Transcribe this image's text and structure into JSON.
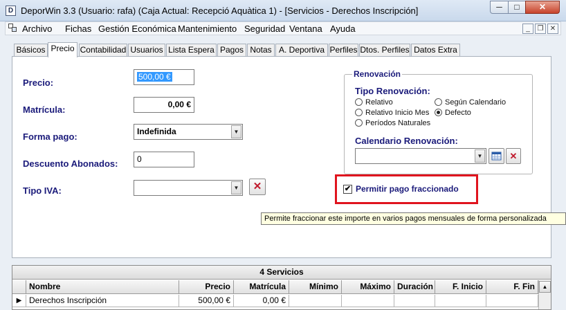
{
  "window": {
    "title": "DeporWin 3.3  (Usuario: rafa)  (Caja Actual: Recepció Aquàtica 1) - [Servicios - Derechos Inscripción]",
    "icon_letter": "D",
    "min_glyph": "─",
    "max_glyph": "□",
    "close_glyph": "✕"
  },
  "menu": {
    "items": [
      "Archivo",
      "Fichas",
      "Gestión Económica",
      "Mantenimiento",
      "Seguridad",
      "Ventana",
      "Ayuda"
    ],
    "mdi_min": "_",
    "mdi_restore": "❐",
    "mdi_close": "✕"
  },
  "tabs": [
    {
      "label": "Básicos",
      "active": false
    },
    {
      "label": "Precio",
      "active": true
    },
    {
      "label": "Contabilidad",
      "active": false
    },
    {
      "label": "Usuarios",
      "active": false
    },
    {
      "label": "Lista Espera",
      "active": false
    },
    {
      "label": "Pagos",
      "active": false
    },
    {
      "label": "Notas",
      "active": false
    },
    {
      "label": "A. Deportiva",
      "active": false
    },
    {
      "label": "Perfiles",
      "active": false
    },
    {
      "label": "Dtos. Perfiles",
      "active": false
    },
    {
      "label": "Datos Extra",
      "active": false
    }
  ],
  "form": {
    "precio_label": "Precio:",
    "precio_value": "500,00 €",
    "matricula_label": "Matrícula:",
    "matricula_value": "0,00 €",
    "forma_pago_label": "Forma pago:",
    "forma_pago_value": "Indefinida",
    "descuento_label": "Descuento Abonados:",
    "descuento_value": "0",
    "tipo_iva_label": "Tipo IVA:",
    "tipo_iva_value": "",
    "clear_glyph": "✕"
  },
  "renovacion": {
    "legend": "Renovación",
    "tipo_label": "Tipo Renovación:",
    "options": {
      "relativo": "Relativo",
      "relativo_inicio_mes": "Relativo Inicio Mes",
      "periodos_naturales": "Períodos Naturales",
      "segun_calendario": "Según Calendario",
      "defecto": "Defecto"
    },
    "selected": "Defecto",
    "calendario_label": "Calendario Renovación:",
    "calendario_value": ""
  },
  "fraccionado": {
    "label": "Permitir pago fraccionado",
    "checked": true,
    "check_glyph": "✔",
    "tooltip": "Permite fraccionar este importe en varios pagos mensuales de forma personalizada"
  },
  "grid": {
    "caption": "4 Servicios",
    "columns": [
      "Nombre",
      "Precio",
      "Matrícula",
      "Mínimo",
      "Máximo",
      "Duración",
      "F. Inicio",
      "F. Fin"
    ],
    "rows": [
      {
        "nombre": "Derechos Inscripción",
        "precio": "500,00 €",
        "matricula": "0,00 €"
      }
    ],
    "row_indicator": "▶",
    "scroll_up": "▲"
  }
}
